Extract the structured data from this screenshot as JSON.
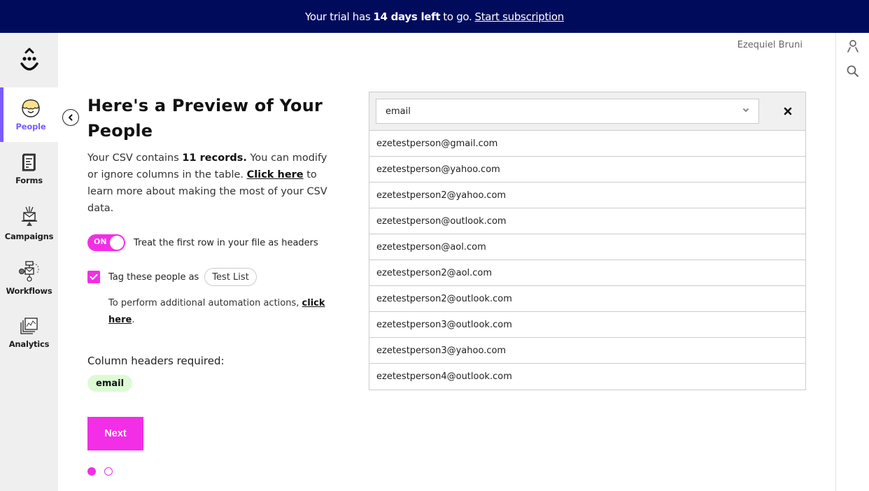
{
  "banner": {
    "prefix": "Your trial has",
    "highlight": "14 days left",
    "suffix": "to go.",
    "link": "Start subscription"
  },
  "sidebar": {
    "logo_icon": "smiley-drop-logo",
    "items": [
      {
        "label": "People",
        "icon": "people-avatar-icon",
        "active": true
      },
      {
        "label": "Forms",
        "icon": "form-document-icon",
        "active": false
      },
      {
        "label": "Campaigns",
        "icon": "campaign-envelope-icon",
        "active": false
      },
      {
        "label": "Workflows",
        "icon": "workflow-icon",
        "active": false
      },
      {
        "label": "Analytics",
        "icon": "analytics-chart-icon",
        "active": false
      }
    ]
  },
  "header": {
    "username": "Ezequiel Bruni"
  },
  "rail": {
    "icons": [
      "user-icon",
      "search-icon"
    ]
  },
  "main": {
    "title": "Here's a Preview of Your People",
    "description": {
      "part1": "Your CSV contains",
      "records": "11 records.",
      "part2": "You can modify or ignore columns in the table.",
      "link": "Click here",
      "part3": "to learn more about making the most of your CSV data."
    },
    "toggle": {
      "state_label": "ON",
      "label": "Treat the first row in your file as headers",
      "on": true
    },
    "tag": {
      "checked": true,
      "label": "Tag these people as",
      "value": "Test List"
    },
    "automation": {
      "text": "To perform additional automation actions,",
      "link": "click here",
      "end": "."
    },
    "required": {
      "label": "Column headers required:",
      "chips": [
        "email"
      ]
    },
    "next_label": "Next",
    "pagination": {
      "total": 2,
      "current": 1
    }
  },
  "table": {
    "column_select": "email",
    "rows": [
      "ezetestperson@gmail.com",
      "ezetestperson@yahoo.com",
      "ezetestperson2@yahoo.com",
      "ezetestperson@outlook.com",
      "ezetestperson@aol.com",
      "ezetestperson2@aol.com",
      "ezetestperson2@outlook.com",
      "ezetestperson3@outlook.com",
      "ezetestperson3@yahoo.com",
      "ezetestperson4@outlook.com"
    ]
  },
  "colors": {
    "banner_bg": "#000b5b",
    "accent": "#f22ee6",
    "active_nav": "#7b5cff",
    "chip_bg": "#dcfbd4"
  }
}
